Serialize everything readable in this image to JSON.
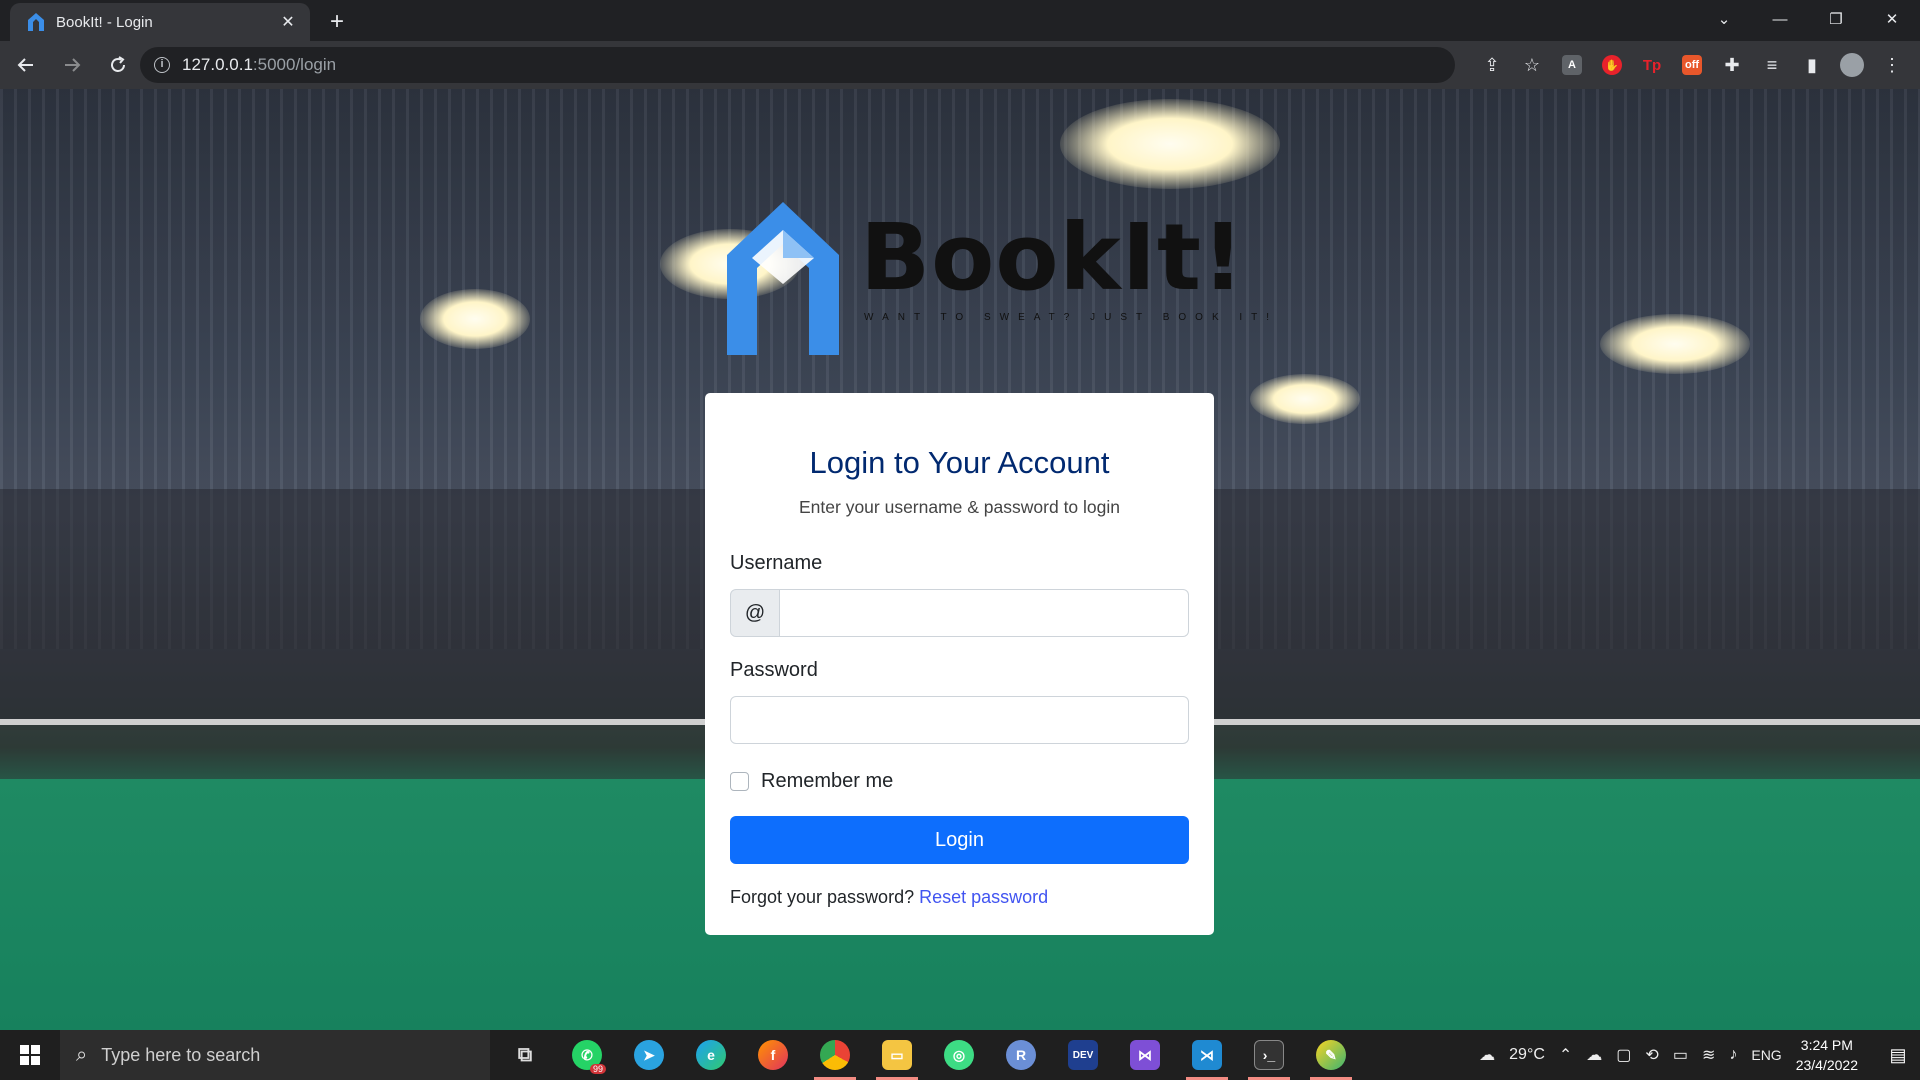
{
  "browser": {
    "tab_title": "BookIt! - Login",
    "new_tab_symbol": "+",
    "url_host": "127.0.0.1",
    "url_path": ":5000/login",
    "extensions": [
      "share-icon",
      "star-icon",
      "pdf-icon",
      "adblock-icon",
      "tp-icon",
      "off-icon",
      "puzzle-icon",
      "media-icon",
      "sidepanel-icon",
      "profile-avatar",
      "menu-icon"
    ]
  },
  "logo": {
    "name": "BookIt!",
    "tagline": "WANT TO SWEAT? JUST BOOK IT!"
  },
  "login": {
    "title": "Login to Your Account",
    "subtitle": "Enter your username & password to login",
    "username_label": "Username",
    "username_prefix": "@",
    "username_value": "",
    "password_label": "Password",
    "password_value": "",
    "remember_label": "Remember me",
    "remember_checked": false,
    "submit_label": "Login",
    "forgot_text": "Forgot your password?",
    "reset_link": "Reset password"
  },
  "taskbar": {
    "search_placeholder": "Type here to search",
    "whatsapp_badge": "99",
    "weather": "29°C",
    "language": "ENG",
    "time": "3:24 PM",
    "date": "23/4/2022"
  },
  "colors": {
    "primary": "#0d6efd",
    "title": "#012970",
    "link": "#4154f1",
    "logo_blue": "#3b8ee8"
  }
}
